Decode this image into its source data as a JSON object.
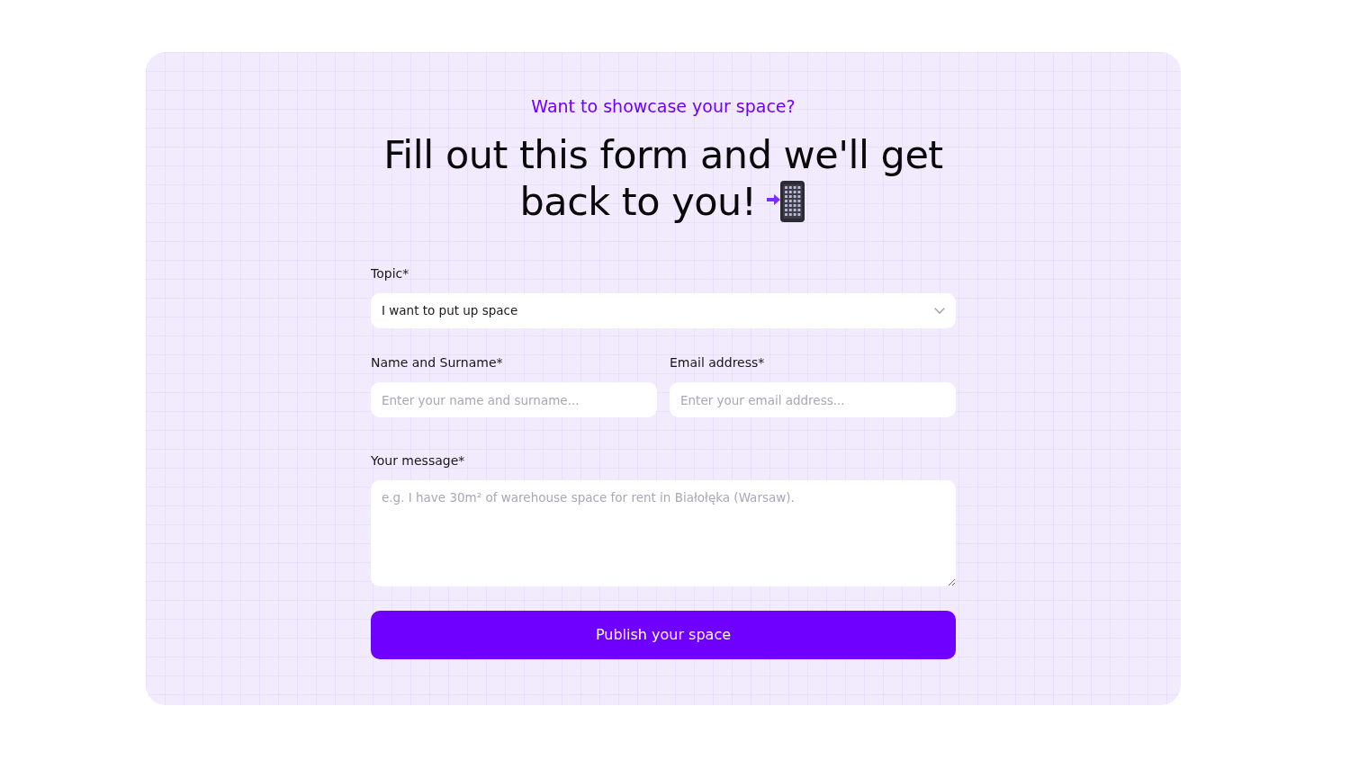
{
  "intro": {
    "eyebrow": "Want to showcase your space?",
    "heading_lines": [
      "Fill out this form and we'll get",
      "back to you!"
    ]
  },
  "form": {
    "rows": [
      [
        {
          "kind": "select",
          "label": "Topic*",
          "value": "I want to put up space"
        }
      ],
      [
        {
          "kind": "input",
          "label": "Name and Surname*",
          "placeholder": "Enter your name and surname..."
        },
        {
          "kind": "input",
          "label": "Email address*",
          "placeholder": "Enter your email address..."
        }
      ],
      [
        {
          "kind": "textarea",
          "label": "Your message*",
          "placeholder": "e.g. I have 30m² of warehouse space for rent in Białołęka (Warsaw)."
        }
      ]
    ],
    "submit": "Publish your space"
  }
}
